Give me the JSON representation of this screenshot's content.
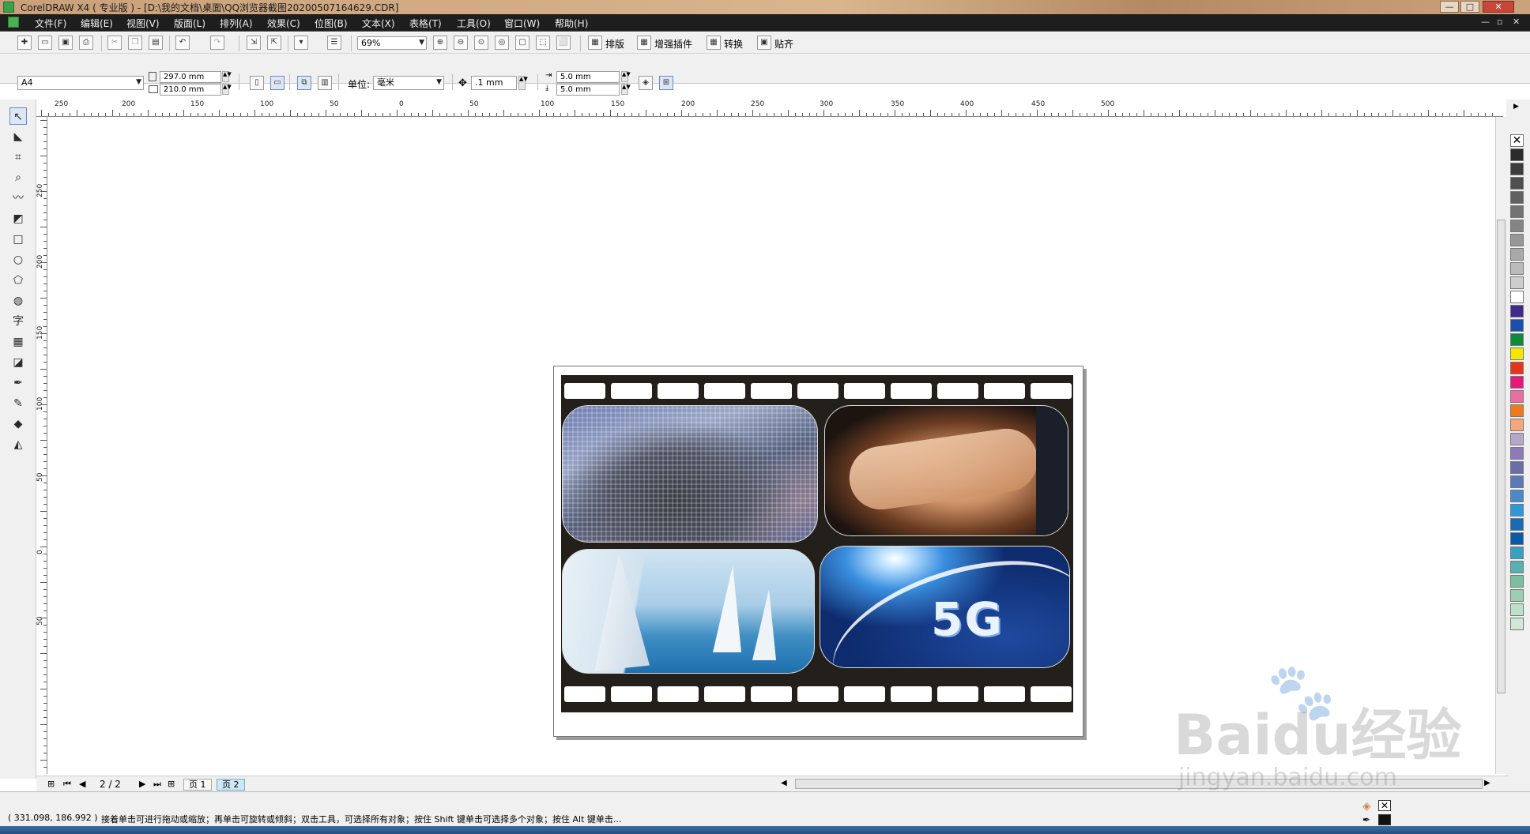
{
  "window": {
    "title": "CorelDRAW X4 ( 专业版 ) - [D:\\我的文档\\桌面\\QQ浏览器截图20200507164629.CDR]",
    "minimize": "—",
    "maximize": "□",
    "close": "✕"
  },
  "menu": {
    "items": [
      "文件(F)",
      "编辑(E)",
      "视图(V)",
      "版面(L)",
      "排列(A)",
      "效果(C)",
      "位图(B)",
      "文本(X)",
      "表格(T)",
      "工具(O)",
      "窗口(W)",
      "帮助(H)"
    ],
    "mdi_min": "—",
    "mdi_restore": "▫",
    "mdi_close": "✕"
  },
  "toolbar": {
    "zoom": "69%",
    "buttons": [
      "排版",
      "增强插件",
      "转换",
      "贴齐"
    ]
  },
  "propertybar": {
    "paper": "A4",
    "width": "297.0 mm",
    "height": "210.0 mm",
    "unit_label": "单位:",
    "unit": "毫米",
    "nudge": ".1 mm",
    "dup_x": "5.0 mm",
    "dup_y": "5.0 mm"
  },
  "ruler": {
    "horizontal": [
      "250",
      "200",
      "150",
      "100",
      "50",
      "0",
      "50",
      "100",
      "150",
      "200",
      "250",
      "300",
      "350",
      "400",
      "450",
      "500"
    ],
    "vertical": [
      "250",
      "200",
      "150",
      "100",
      "50",
      "0",
      "50"
    ]
  },
  "document": {
    "fiveg_label": "5G"
  },
  "navigator": {
    "page_count": "2 / 2",
    "tabs": [
      "页 1",
      "页 2"
    ]
  },
  "status": {
    "coords": "( 331.098, 186.992 )",
    "hint": "接着单击可进行拖动或缩放；再单击可旋转或倾斜；双击工具，可选择所有对象；按住 Shift 键单击可选择多个对象；按住 Alt 键单击..."
  },
  "palette": {
    "colors": [
      "#2b2b2b",
      "#3d3d3d",
      "#4f4f4f",
      "#616161",
      "#737373",
      "#858585",
      "#979797",
      "#a9a9a9",
      "#bbbbbb",
      "#cdcdcd",
      "#ffffff",
      "#3f2a8c",
      "#1a4fb0",
      "#0d8a3a",
      "#f5e600",
      "#e8331c",
      "#e6197a",
      "#e86fa0",
      "#f07a1a",
      "#f4a77a",
      "#b8a6c8",
      "#8c7bb8",
      "#6c6ca8",
      "#5a7ab8",
      "#4a8ac8",
      "#2a9ad8",
      "#1a6ab8",
      "#0a5aa8",
      "#3aa0c0",
      "#5ab0b0",
      "#7ac0a0",
      "#9ad0b0",
      "#bde0c8",
      "#d0e8d8"
    ]
  },
  "watermark": {
    "brand": "Baidu经验",
    "url": "jingyan.baidu.com"
  }
}
